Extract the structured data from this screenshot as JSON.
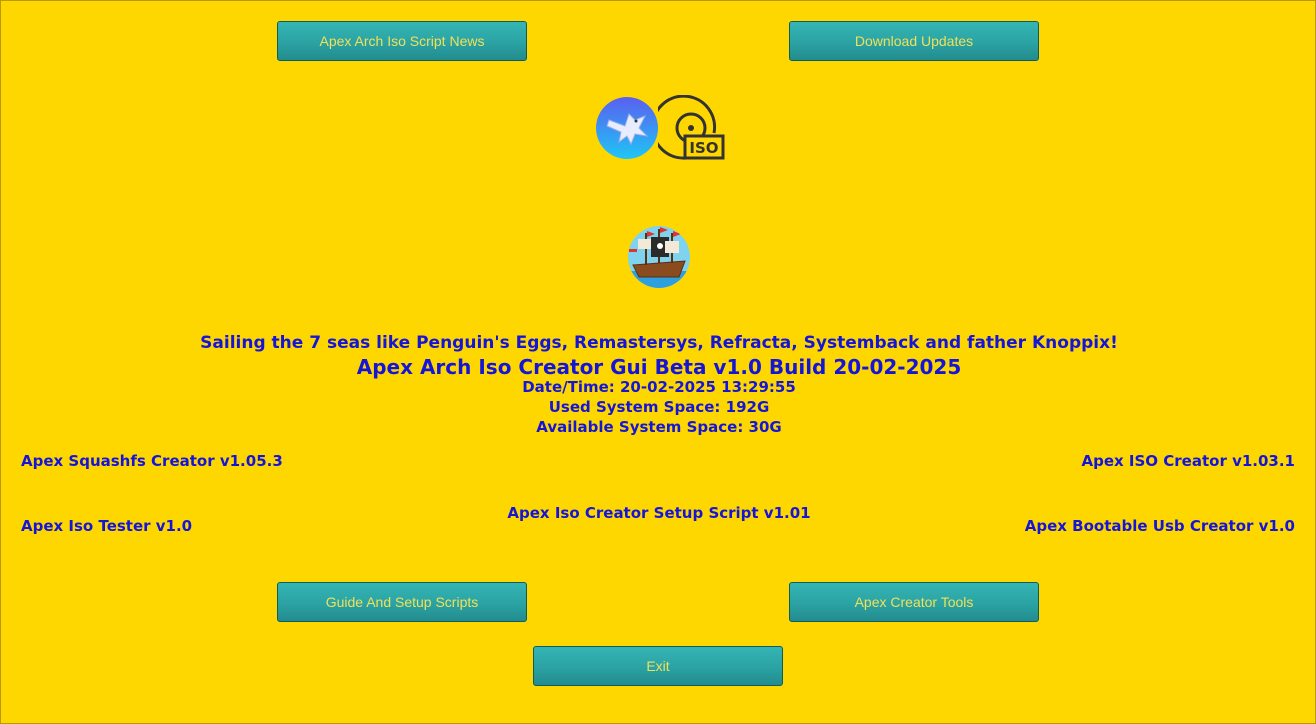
{
  "buttons": {
    "news": "Apex Arch Iso Script News",
    "updates": "Download Updates",
    "guide": "Guide And Setup Scripts",
    "tools": "Apex Creator Tools",
    "exit": "Exit"
  },
  "icons": {
    "eagle": "eagle-logo-icon",
    "iso": "iso-disc-icon",
    "ship": "pirate-ship-icon",
    "iso_label": "ISO"
  },
  "info": {
    "tagline": "Sailing the 7 seas like Penguin's Eggs, Remastersys, Refracta, Systemback and father Knoppix!",
    "title": "Apex Arch Iso Creator Gui Beta v1.0 Build 20-02-2025",
    "datetime": "Date/Time: 20-02-2025 13:29:55",
    "used_space": "Used System Space: 192G",
    "available_space": "Available System Space: 30G"
  },
  "links": {
    "squashfs": "Apex Squashfs Creator v1.05.3",
    "iso_creator": "Apex ISO Creator v1.03.1",
    "setup_script": "Apex Iso Creator Setup Script v1.01",
    "iso_tester": "Apex Iso Tester v1.0",
    "usb_creator": "Apex Bootable Usb Creator v1.0"
  },
  "colors": {
    "background": "#ffd700",
    "text": "#1515d8",
    "button": "#2ba2a3",
    "button_text": "#f0e05a"
  }
}
